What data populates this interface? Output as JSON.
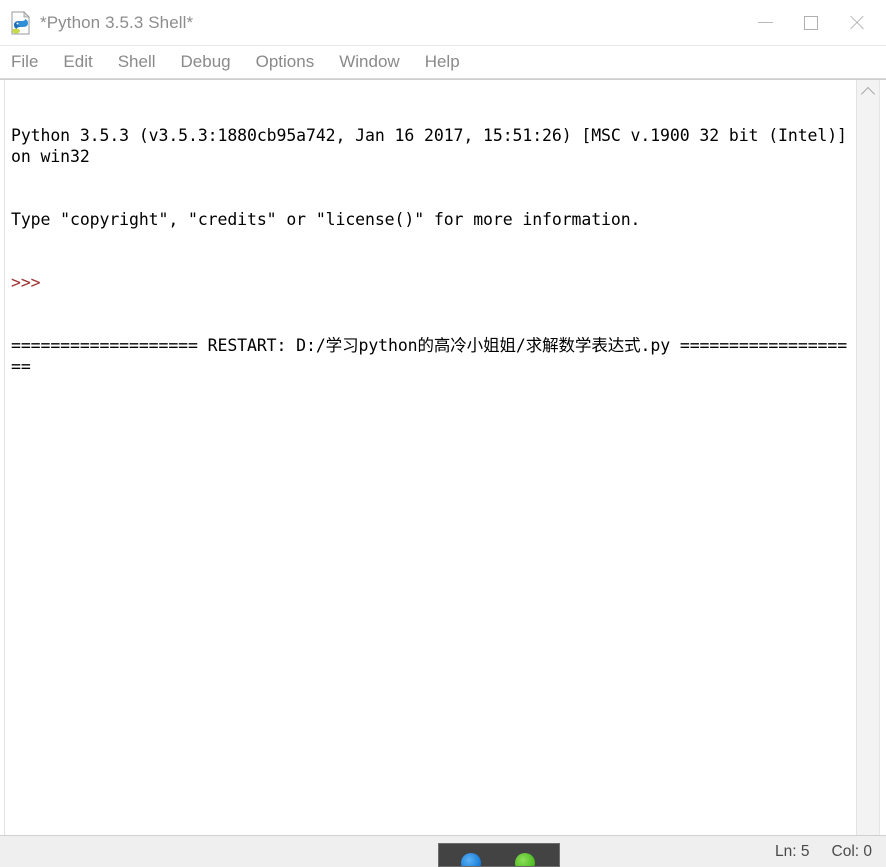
{
  "window": {
    "title": "*Python 3.5.3 Shell*",
    "icon": "python-idle-icon",
    "controls": {
      "minimize_label": "Minimize",
      "maximize_label": "Maximize",
      "close_label": "Close"
    }
  },
  "menubar": {
    "items": [
      {
        "label": "File"
      },
      {
        "label": "Edit"
      },
      {
        "label": "Shell"
      },
      {
        "label": "Debug"
      },
      {
        "label": "Options"
      },
      {
        "label": "Window"
      },
      {
        "label": "Help"
      }
    ]
  },
  "console": {
    "lines": [
      {
        "text": "Python 3.5.3 (v3.5.3:1880cb95a742, Jan 16 2017, 15:51:26) [MSC v.1900 32 bit (Intel)] on win32",
        "kind": "output"
      },
      {
        "text": "Type \"copyright\", \"credits\" or \"license()\" for more information.",
        "kind": "output"
      },
      {
        "text": ">>>",
        "kind": "prompt"
      },
      {
        "text": "=================== RESTART: D:/学习python的高冷小姐姐/求解数学表达式.py ===================",
        "kind": "restart"
      }
    ],
    "restart_path": "D:/学习python的高冷小姐姐/求解数学表达式.py",
    "prompt_symbol": ">>>",
    "prompt_color": "#a03232",
    "text_color": "#000000",
    "background": "#ffffff"
  },
  "scrollbar": {
    "up_arrow": "chevron-up-icon",
    "orientation": "vertical"
  },
  "statusbar": {
    "line_label": "Ln: 5",
    "col_label": "Col: 0"
  },
  "taskbar": {
    "visible": true,
    "background": "#434343",
    "icons": [
      {
        "name": "blue-app-icon",
        "color": "#1478d6"
      },
      {
        "name": "green-app-icon",
        "color": "#46b81e"
      }
    ]
  }
}
